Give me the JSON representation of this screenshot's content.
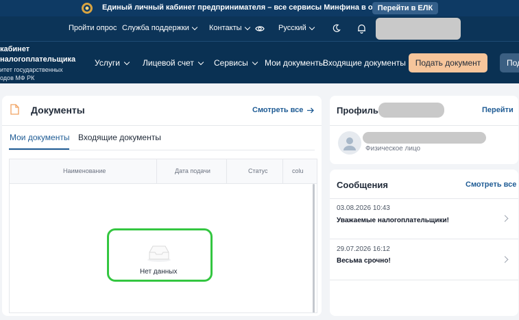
{
  "banner": {
    "text": "Единый личный кабинет предпринимателя – все сервисы Минфина в одном окне",
    "button": "Перейти в ЕЛК"
  },
  "util_nav": {
    "survey": "Пройти опрос",
    "support": "Служба поддержки",
    "contacts": "Контакты",
    "language": "Русский"
  },
  "brand": {
    "line1": "кабинет",
    "line2": "налогоплательщика",
    "line3": "итет государственных",
    "line4": "одов МФ РК"
  },
  "main_nav": {
    "services": "Услуги",
    "account": "Лицевой счет",
    "tools": "Сервисы",
    "my_docs": "Мои документы",
    "incoming_docs": "Входящие документы",
    "submit_button": "Подать документ",
    "cut_button": "Под"
  },
  "documents": {
    "title": "Документы",
    "see_all": "Смотреть все",
    "tabs": [
      "Мои документы",
      "Входящие документы"
    ],
    "columns": [
      "Наименование",
      "Дата подачи",
      "Статус",
      "colu"
    ],
    "empty_text": "Нет данных"
  },
  "profile": {
    "title": "Профиль",
    "go": "Перейти",
    "type": "Физическое лицо"
  },
  "messages": {
    "title": "Сообщения",
    "see_all": "Смотреть все",
    "items": [
      {
        "date": "03.08.2026 10:43",
        "text": "Уважаемые налогоплательщики!"
      },
      {
        "date": "29.07.2026 16:12",
        "text": "Весьма срочно!"
      }
    ]
  },
  "colors": {
    "banner_bg": "#0e3a64",
    "nav_bg": "#0a3153",
    "accent": "#1e5b94",
    "submit_bg": "#f6c59b",
    "highlight": "#33c640"
  }
}
